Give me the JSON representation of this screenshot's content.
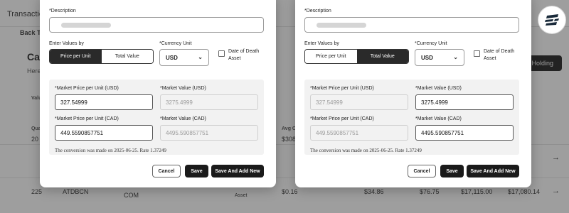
{
  "background": {
    "nav_transactions": "Transactio",
    "back": "Back To",
    "card_heading": "Car",
    "card_sub": "Here",
    "col_value": "Valu",
    "col_quantity": "Qua",
    "col_avg": "Avg C",
    "add_holding": "d Holding",
    "rows": [
      {
        "a": "20",
        "b": "$308",
        "arrow": "→"
      },
      {
        "a": "225",
        "b": "ATDBCN",
        "c": "$0.16",
        "d": "$34.86",
        "e": "$76.75",
        "f": "$17,115.00",
        "g": "$17,080.14",
        "arrow": "→"
      }
    ],
    "row2_extra": "COM",
    "row2_extra2": "Asset"
  },
  "logo": {
    "icon": "app-logo-icon"
  },
  "modals": [
    {
      "description_label": "*Description",
      "enter_values_label": "Enter Values by",
      "mode_price_per_unit": "Price per Unit",
      "mode_total_value": "Total Value",
      "active_mode": "price_per_unit",
      "currency_label": "*Currency Unit",
      "currency_value": "USD",
      "date_of_death_label_line1": "Date of Death",
      "date_of_death_label_line2": "Asset",
      "mpu_usd_label": "*Market Price per Unit (USD)",
      "mpu_usd_value": "327.54999",
      "mv_usd_label": "*Market Value (USD)",
      "mv_usd_value": "3275.4999",
      "mpu_cad_label": "*Market Price per Unit (CAD)",
      "mpu_cad_value": "449.5590857751",
      "mv_cad_label": "*Market Value (CAD)",
      "mv_cad_value": "4495.590857751",
      "conversion_note": "The conversion was made on 2025-06-25. Rate 1.37249",
      "cancel": "Cancel",
      "save": "Save",
      "save_add_new": "Save And Add New"
    },
    {
      "description_label": "*Description",
      "enter_values_label": "Enter Values by",
      "mode_price_per_unit": "Price per Unit",
      "mode_total_value": "Total Value",
      "active_mode": "total_value",
      "currency_label": "*Currency Unit",
      "currency_value": "USD",
      "date_of_death_label_line1": "Date of Death",
      "date_of_death_label_line2": "Asset",
      "mpu_usd_label": "*Market Price per Unit (USD)",
      "mpu_usd_value": "327.54999",
      "mv_usd_label": "*Market Value (USD)",
      "mv_usd_value": "3275.4999",
      "mpu_cad_label": "*Market Price per Unit (CAD)",
      "mpu_cad_value": "449.5590857751",
      "mv_cad_label": "*Market Value (CAD)",
      "mv_cad_value": "4495.590857751",
      "conversion_note": "The conversion was made on 2025-06-25. Rate 1.37249",
      "cancel": "Cancel",
      "save": "Save",
      "save_add_new": "Save And Add New"
    }
  ]
}
